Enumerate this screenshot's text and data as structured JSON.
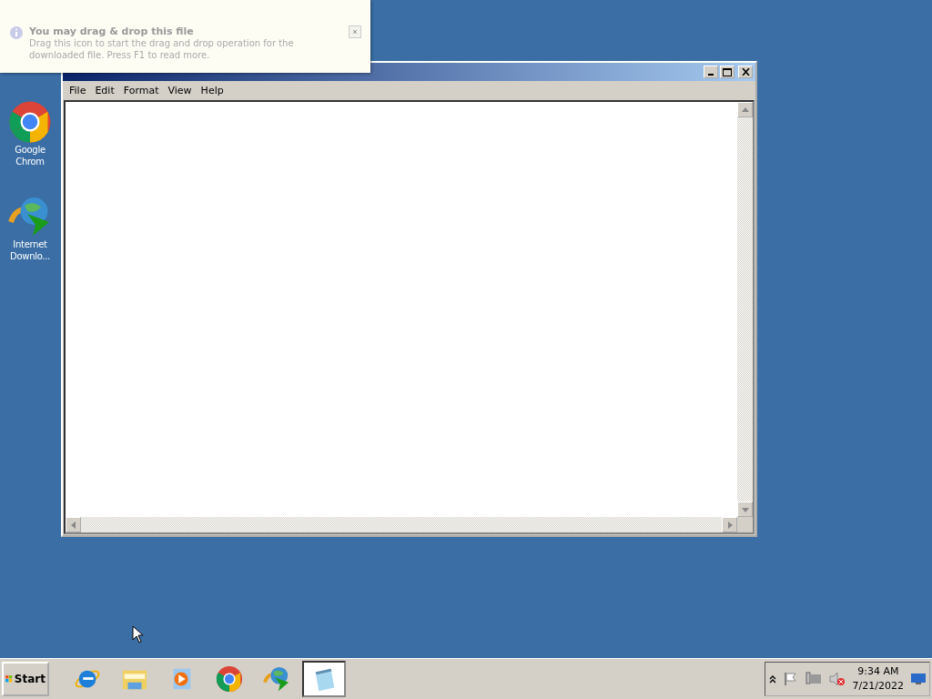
{
  "notification": {
    "title": "You may drag & drop this file",
    "message": "Drag this icon to start the drag and drop operation for the downloaded file. Press F1 to read more.",
    "close": "×"
  },
  "desktop_icons": [
    {
      "kind": "chrome",
      "label": "Google Chrom"
    },
    {
      "kind": "idm",
      "label": "Internet Downlo..."
    }
  ],
  "notepad": {
    "menu": [
      "File",
      "Edit",
      "Format",
      "View",
      "Help"
    ]
  },
  "taskbar": {
    "start": "Start",
    "items": [
      {
        "kind": "ie",
        "selected": false
      },
      {
        "kind": "folder",
        "selected": false
      },
      {
        "kind": "media",
        "selected": false
      },
      {
        "kind": "chrome",
        "selected": false
      },
      {
        "kind": "idm",
        "selected": false
      },
      {
        "kind": "notepad",
        "selected": true
      }
    ],
    "clock": {
      "time": "9:34 AM",
      "date": "7/21/2022"
    }
  }
}
